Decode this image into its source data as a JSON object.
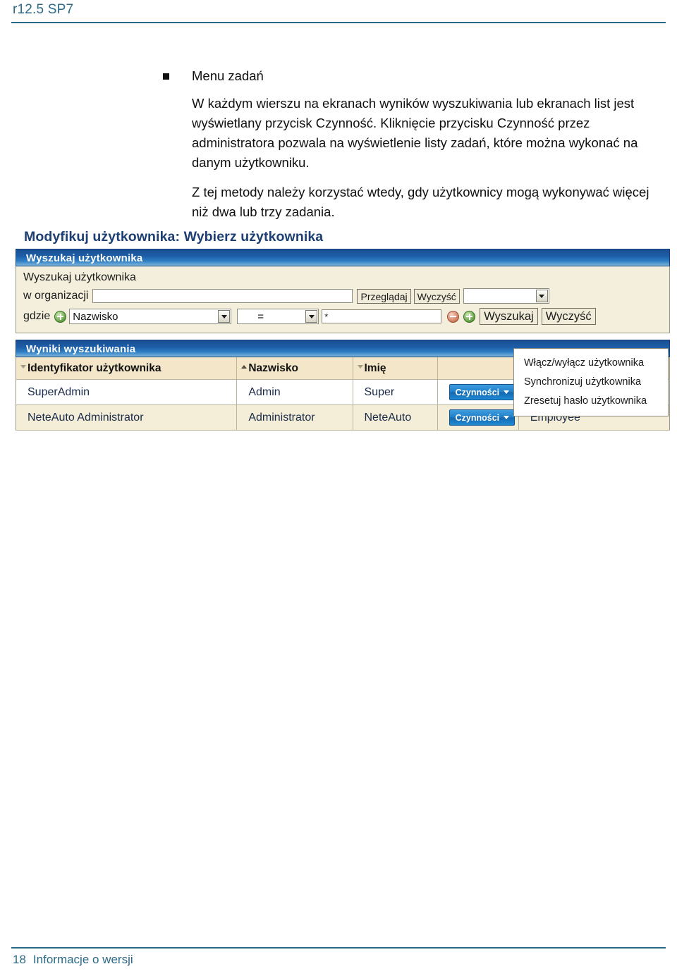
{
  "header": {
    "version_label": "r12.5 SP7"
  },
  "footer": {
    "page_number": "18",
    "doc_title": "Informacje o wersji"
  },
  "content": {
    "bullet_title": "Menu zadań",
    "paragraph_1": "W każdym wierszu na ekranach wyników wyszukiwania lub ekranach list jest wyświetlany przycisk Czynność. Kliknięcie przycisku Czynność przez administratora pozwala na wyświetlenie listy zadań, które można wykonać na danym użytkowniku.",
    "paragraph_2": "Z tej metody należy korzystać wtedy, gdy użytkownicy mogą wykonywać więcej niż dwa lub trzy zadania."
  },
  "screenshot": {
    "title": "Modyfikuj użytkownika: Wybierz użytkownika",
    "search_panel": {
      "header": "Wyszukaj użytkownika",
      "subheader": "Wyszukaj użytkownika",
      "org_label": "w organizacji",
      "org_value": "",
      "browse_button": "Przeglądaj",
      "clear_button": "Wyczyść",
      "org_select_value": "",
      "where_label": "gdzie",
      "add_icon": "plus-circle-icon",
      "field_select_value": "Nazwisko",
      "operator_select_value": "=",
      "criteria_value": "*",
      "remove_row_icon": "minus-circle-icon",
      "add_row_icon": "plus-circle-icon",
      "search_button": "Wyszukaj",
      "reset_button": "Wyczyść"
    },
    "results_panel": {
      "header": "Wyniki wyszukiwania",
      "columns": [
        {
          "label": "Identyfikator użytkownika",
          "sort": "desc"
        },
        {
          "label": "Nazwisko",
          "sort": "asc"
        },
        {
          "label": "Imię",
          "sort": "desc"
        },
        {
          "label": "",
          "sort": "none"
        },
        {
          "label": "",
          "sort": "none"
        }
      ],
      "rows": [
        {
          "user_id": "SuperAdmin",
          "last_name": "Admin",
          "first_name": "Super",
          "action_button": "Czynności",
          "extra": ""
        },
        {
          "user_id": "NeteAuto Administrator",
          "last_name": "Administrator",
          "first_name": "NeteAuto",
          "action_button": "Czynności",
          "extra": "Employee"
        }
      ],
      "context_menu": {
        "items": [
          "Włącz/wyłącz użytkownika",
          "Synchronizuj użytkownika",
          "Zresetuj hasło użytkownika"
        ]
      }
    }
  },
  "colors": {
    "accent_blue": "#2b6a86",
    "panel_blue": "#1d5ea8",
    "title_blue": "#1d3f73",
    "panel_bg": "#f4efdc",
    "row_alt": "#f4eed9",
    "button_blue": "#1f7ec6"
  }
}
